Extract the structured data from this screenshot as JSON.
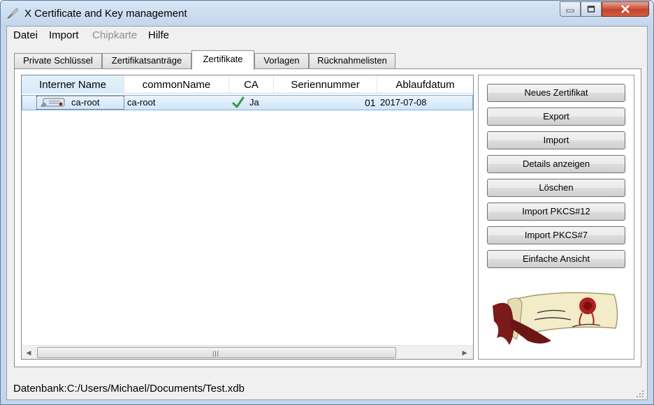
{
  "window": {
    "title": "X Certificate and Key management",
    "title_icon": "feather-pen-icon",
    "controls": {
      "minimize": "minimize-icon",
      "maximize": "maximize-icon",
      "close": "close-icon"
    }
  },
  "menu": {
    "items": [
      {
        "label": "Datei",
        "enabled": true
      },
      {
        "label": "Import",
        "enabled": true
      },
      {
        "label": "Chipkarte",
        "enabled": false
      },
      {
        "label": "Hilfe",
        "enabled": true
      }
    ]
  },
  "tabs": [
    {
      "label": "Private Schlüssel",
      "active": false
    },
    {
      "label": "Zertifikatsanträge",
      "active": false
    },
    {
      "label": "Zertifikate",
      "active": true
    },
    {
      "label": "Vorlagen",
      "active": false
    },
    {
      "label": "Rücknahmelisten",
      "active": false
    }
  ],
  "table": {
    "columns": [
      "Interner Name",
      "commonName",
      "CA",
      "Seriennummer",
      "Ablaufdatum"
    ],
    "sorted_column": "Interner Name",
    "rows": [
      {
        "internal_name": "ca-root",
        "common_name": "ca-root",
        "ca": "Ja",
        "serial": "01",
        "expiry": "2017-07-08",
        "icon": "certificate-icon",
        "ca_icon": "checkmark-icon",
        "selected": true
      }
    ],
    "scrollbar": {
      "left_arrow": "◀",
      "right_arrow": "▶",
      "grip": "|||"
    }
  },
  "buttons": [
    "Neues Zertifikat",
    "Export",
    "Import",
    "Details anzeigen",
    "Löschen",
    "Import PKCS#12",
    "Import PKCS#7",
    "Einfache Ansicht"
  ],
  "logo": {
    "icon": "certificate-scroll-logo-icon"
  },
  "status": {
    "text": "Datenbank:C:/Users/Michael/Documents/Test.xdb"
  },
  "colors": {
    "selection": "#cfe5fa",
    "selection_border": "#84acdd",
    "check": "#3a9a3a",
    "seal": "#b02020"
  }
}
